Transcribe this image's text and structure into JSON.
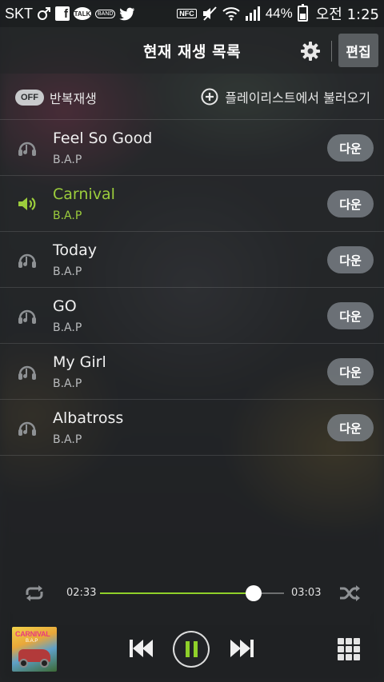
{
  "status_bar": {
    "carrier": "SKT",
    "icons": [
      "male-sign-icon",
      "facebook-icon",
      "kakaotalk-icon",
      "band-icon",
      "twitter-icon",
      "nfc-icon",
      "mute-icon",
      "wifi-icon",
      "signal-icon",
      "battery-icon"
    ],
    "talk_label": "TALK",
    "band_label": "BAND",
    "nfc_label": "NFC",
    "battery_percent": "44%",
    "battery_level": 0.44,
    "time": "오전 1:25"
  },
  "header": {
    "title": "현재 재생 목록",
    "settings_icon": "gear-icon",
    "edit_label": "편집"
  },
  "options": {
    "repeat_toggle": "OFF",
    "repeat_label": "반복재생",
    "load_playlist_label": "플레이리스트에서 불러오기"
  },
  "playlist": [
    {
      "title": "Feel So Good",
      "artist": "B.A.P",
      "down_label": "다운",
      "active": false
    },
    {
      "title": "Carnival",
      "artist": "B.A.P",
      "down_label": "다운",
      "active": true
    },
    {
      "title": "Today",
      "artist": "B.A.P",
      "down_label": "다운",
      "active": false
    },
    {
      "title": "GO",
      "artist": "B.A.P",
      "down_label": "다운",
      "active": false
    },
    {
      "title": "My Girl",
      "artist": "B.A.P",
      "down_label": "다운",
      "active": false
    },
    {
      "title": "Albatross",
      "artist": "B.A.P",
      "down_label": "다운",
      "active": false
    }
  ],
  "player": {
    "current_time": "02:33",
    "total_time": "03:03",
    "progress": 0.836,
    "album_art_text": "CARNIVAL",
    "album_art_sub": "B.A.P",
    "accent_color": "#8fd02a",
    "active_track_color": "#9ccd3c"
  }
}
